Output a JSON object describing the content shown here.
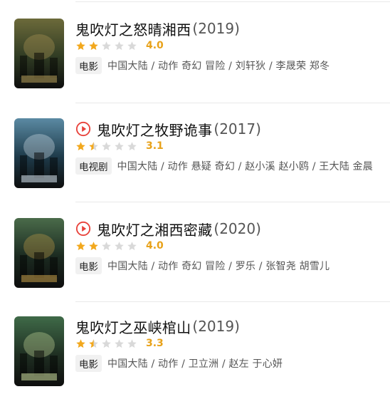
{
  "movies": [
    {
      "title": "鬼吹灯之怒晴湘西",
      "year": "(2019)",
      "score": "4.0",
      "stars_fraction": 0.4,
      "has_play_icon": false,
      "tag": "电影",
      "meta": "中国大陆 / 动作 奇幻 冒险 / 刘轩狄 / 李晟荣 郑冬",
      "poster_colors": [
        "#2f3b23",
        "#6c6a3a",
        "#b59c5a"
      ]
    },
    {
      "title": "鬼吹灯之牧野诡事",
      "year": "(2017)",
      "score": "3.1",
      "stars_fraction": 0.3,
      "has_play_icon": true,
      "tag": "电视剧",
      "meta": "中国大陆 / 动作 悬疑 奇幻 / 赵小溪 赵小鸥 / 王大陆 金晨",
      "poster_colors": [
        "#1e3b4a",
        "#5b8aa3",
        "#d9e6ee"
      ]
    },
    {
      "title": "鬼吹灯之湘西密藏",
      "year": "(2020)",
      "score": "4.0",
      "stars_fraction": 0.4,
      "has_play_icon": true,
      "tag": "电影",
      "meta": "中国大陆 / 动作 奇幻 冒险 / 罗乐 / 张智尧 胡雪儿",
      "poster_colors": [
        "#1b2a20",
        "#4a6b4a",
        "#c9a04a"
      ]
    },
    {
      "title": "鬼吹灯之巫峡棺山",
      "year": "(2019)",
      "score": "3.3",
      "stars_fraction": 0.3,
      "has_play_icon": false,
      "tag": "电影",
      "meta": "中国大陆 / 动作 / 卫立洲 / 赵左 于心妍",
      "poster_colors": [
        "#1f2f22",
        "#3f6a48",
        "#cfe0a0"
      ]
    }
  ],
  "colors": {
    "star_filled": "#f2a81d",
    "star_empty": "#d9d9d9",
    "score": "#e8a21a",
    "play_icon": "#e8413a"
  },
  "icons": {
    "play": "play-circle-icon",
    "star": "star-icon"
  }
}
